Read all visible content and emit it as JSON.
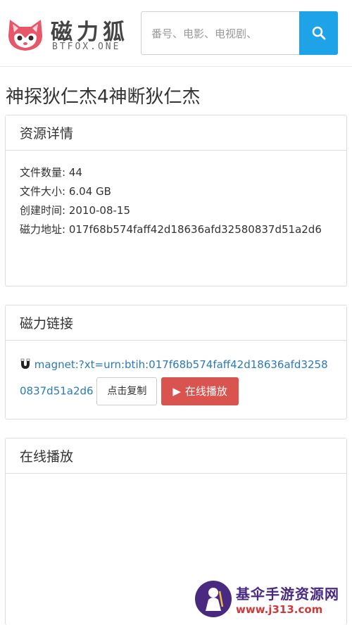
{
  "header": {
    "logo_text": "磁力狐",
    "logo_sub": "BTFOX.ONE",
    "search_placeholder": "番号、电影、电视剧、",
    "search_icon": "search-icon",
    "accent_color": "#1ea3e9"
  },
  "title": "神探狄仁杰4神断狄仁杰",
  "details": {
    "heading": "资源详情",
    "rows": [
      {
        "key": "文件数量:",
        "value": "44"
      },
      {
        "key": "文件大小:",
        "value": "6.04 GB"
      },
      {
        "key": "创建时间:",
        "value": "2010-08-15"
      },
      {
        "key": "磁力地址:",
        "value": "017f68b574faff42d18636afd32580837d51a2d6"
      }
    ]
  },
  "magnet": {
    "heading": "磁力链接",
    "icon": "magnet-icon",
    "link": "magnet:?xt=urn:btih:017f68b574faff42d18636afd32580837d51a2d6",
    "copy_label": "点击复制",
    "play_label": "在线播放",
    "play_color": "#d9534f"
  },
  "online": {
    "heading": "在线播放"
  },
  "watermark": {
    "title": "基伞手游资源网",
    "url": "www.j313.com"
  }
}
